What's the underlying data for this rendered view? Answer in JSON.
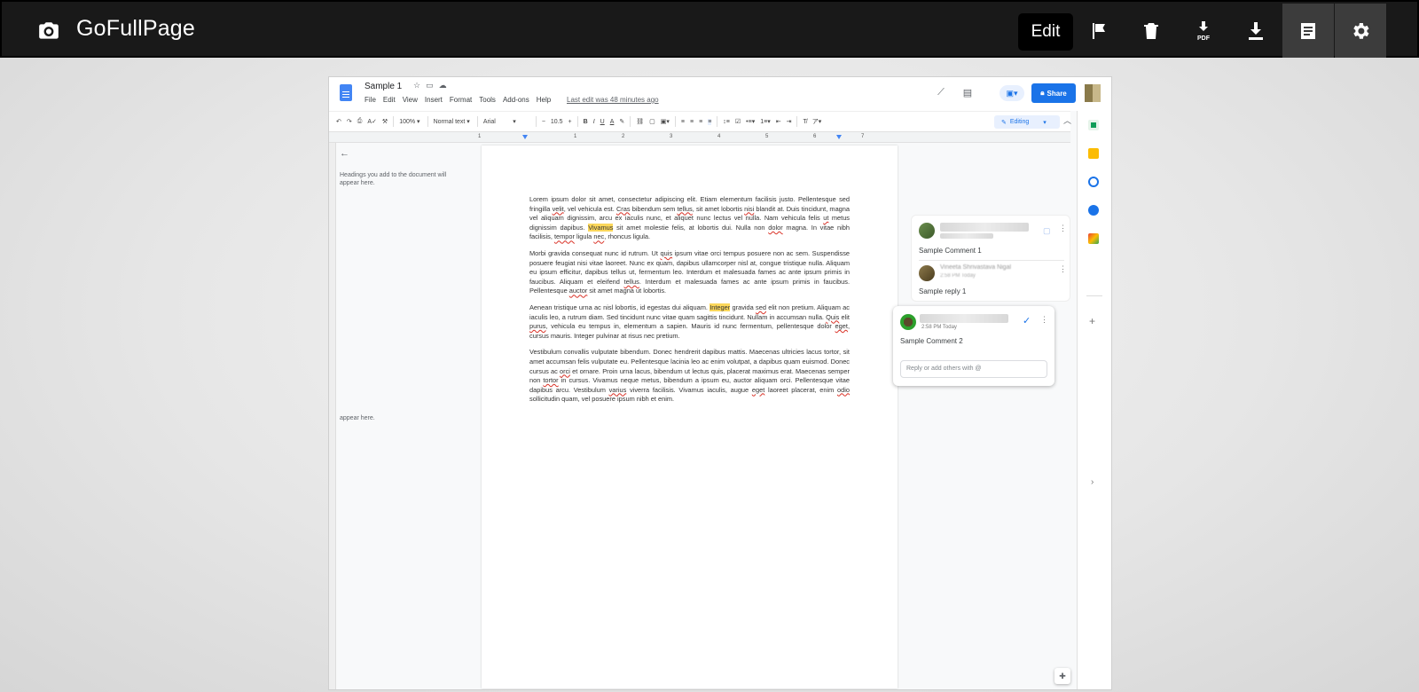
{
  "extension": {
    "title": "GoFullPage",
    "edit_label": "Edit",
    "buttons": [
      {
        "name": "flag-icon"
      },
      {
        "name": "trash-icon"
      },
      {
        "name": "download-pdf-icon"
      },
      {
        "name": "download-icon"
      },
      {
        "name": "document-icon",
        "active": true
      },
      {
        "name": "gear-icon",
        "active": true
      }
    ]
  },
  "docs": {
    "title": "Sample 1",
    "menu": [
      "File",
      "Edit",
      "View",
      "Insert",
      "Format",
      "Tools",
      "Add-ons",
      "Help"
    ],
    "last_edit": "Last edit was 48 minutes ago",
    "share_label": "Share",
    "toolbar": {
      "zoom": "100%",
      "style": "Normal text",
      "font": "Arial",
      "font_size": "10.5",
      "mode": "Editing"
    },
    "ruler_numbers": [
      "1",
      "1",
      "2",
      "3",
      "4",
      "5",
      "6",
      "7"
    ],
    "outline": {
      "back": "←",
      "placeholder": "Headings you add to the document will appear here.",
      "placeholder_fragment": "appear here."
    },
    "paragraphs": {
      "p1_a": "Lorem ipsum dolor sit amet, consectetur adipiscing elit. Etiam elementum facilisis justo. Pellentesque sed fringilla ",
      "p1_w1": "velit",
      "p1_b": ", vel vehicula est. ",
      "p1_w2": "Cras",
      "p1_c": " bibendum sem ",
      "p1_w3": "tellus",
      "p1_d": ", sit amet lobortis ",
      "p1_w4": "nisi",
      "p1_e": " blandit at. Duis tincidunt, magna vel aliquam dignissim, arcu ex iaculis nunc, et aliquet nunc lectus vel nulla. Nam vehicula felis ",
      "p1_w5": "ut",
      "p1_f": " metus dignissim dapibus. ",
      "p1_hl": "Vivamus",
      "p1_g": " sit amet molestie felis, at lobortis dui. Nulla non ",
      "p1_w6": "dolor",
      "p1_h": " magna. In vitae nibh facilisis, ",
      "p1_w7": "tempor",
      "p1_i": " ligula ",
      "p1_w8": "nec",
      "p1_j": ", rhoncus ligula.",
      "p2_a": "Morbi gravida consequat nunc id rutrum. Ut ",
      "p2_w1": "quis",
      "p2_b": " ipsum vitae orci tempus posuere non ac sem. Suspendisse posuere feugiat nisi vitae laoreet. Nunc ex quam, dapibus ullamcorper nisl at, congue tristique nulla. Aliquam eu ipsum efficitur, dapibus tellus ut, fermentum leo. Interdum et malesuada fames ac ante ipsum primis in faucibus. Aliquam et eleifend ",
      "p2_w2": "tellus",
      "p2_c": ". Interdum et malesuada fames ac ante ipsum primis in faucibus. Pellentesque ",
      "p2_w3": "auctor",
      "p2_d": " sit amet magna ut lobortis.",
      "p3_a": "Aenean tristique urna ac nisl lobortis, id egestas dui aliquam. ",
      "p3_hl": "Integer",
      "p3_b": " gravida ",
      "p3_w1": "sed",
      "p3_c": " elit non pretium. Aliquam ac iaculis leo, a rutrum diam. Sed tincidunt nunc vitae quam sagittis tincidunt. Nullam in accumsan nulla. ",
      "p3_w2": "Quis",
      "p3_d": " elit ",
      "p3_w3": "purus",
      "p3_e": ", vehicula eu tempus in, elementum a sapien. Mauris id nunc fermentum, pellentesque dolor ",
      "p3_w4": "eget",
      "p3_f": ", cursus mauris. Integer pulvinar at risus nec pretium.",
      "p4_a": "Vestibulum convallis vulputate bibendum. Donec hendrerit dapibus mattis. Maecenas ultricies lacus tortor, sit amet accumsan felis vulputate eu. Pellentesque lacinia leo ac enim volutpat, a dapibus quam euismod. Donec cursus ac ",
      "p4_w1": "orci",
      "p4_b": " et ornare. Proin urna lacus, bibendum ut lectus quis, placerat maximus erat. Maecenas semper non ",
      "p4_w2": "tortor",
      "p4_c": " in cursus. Vivamus neque metus, bibendum a ipsum eu, auctor aliquam orci. Pellentesque vitae dapibus arcu. Vestibulum ",
      "p4_w3": "varius",
      "p4_d": " viverra facilisis. Vivamus iaculis, augue ",
      "p4_w4": "eget",
      "p4_e": " laoreet placerat, enim ",
      "p4_w5": "odio",
      "p4_f": " sollicitudin quam, vel posuere ipsum nibh et enim."
    },
    "comments": {
      "comment1": "Sample Comment 1",
      "reply_author": "Vineeta Shrivastava Nigal",
      "reply_time": "2:58 PM Today",
      "reply1": "Sample reply 1",
      "comment2_time": "2:58 PM Today",
      "comment2": "Sample Comment 2",
      "reply_placeholder": "Reply or add others with @"
    }
  }
}
